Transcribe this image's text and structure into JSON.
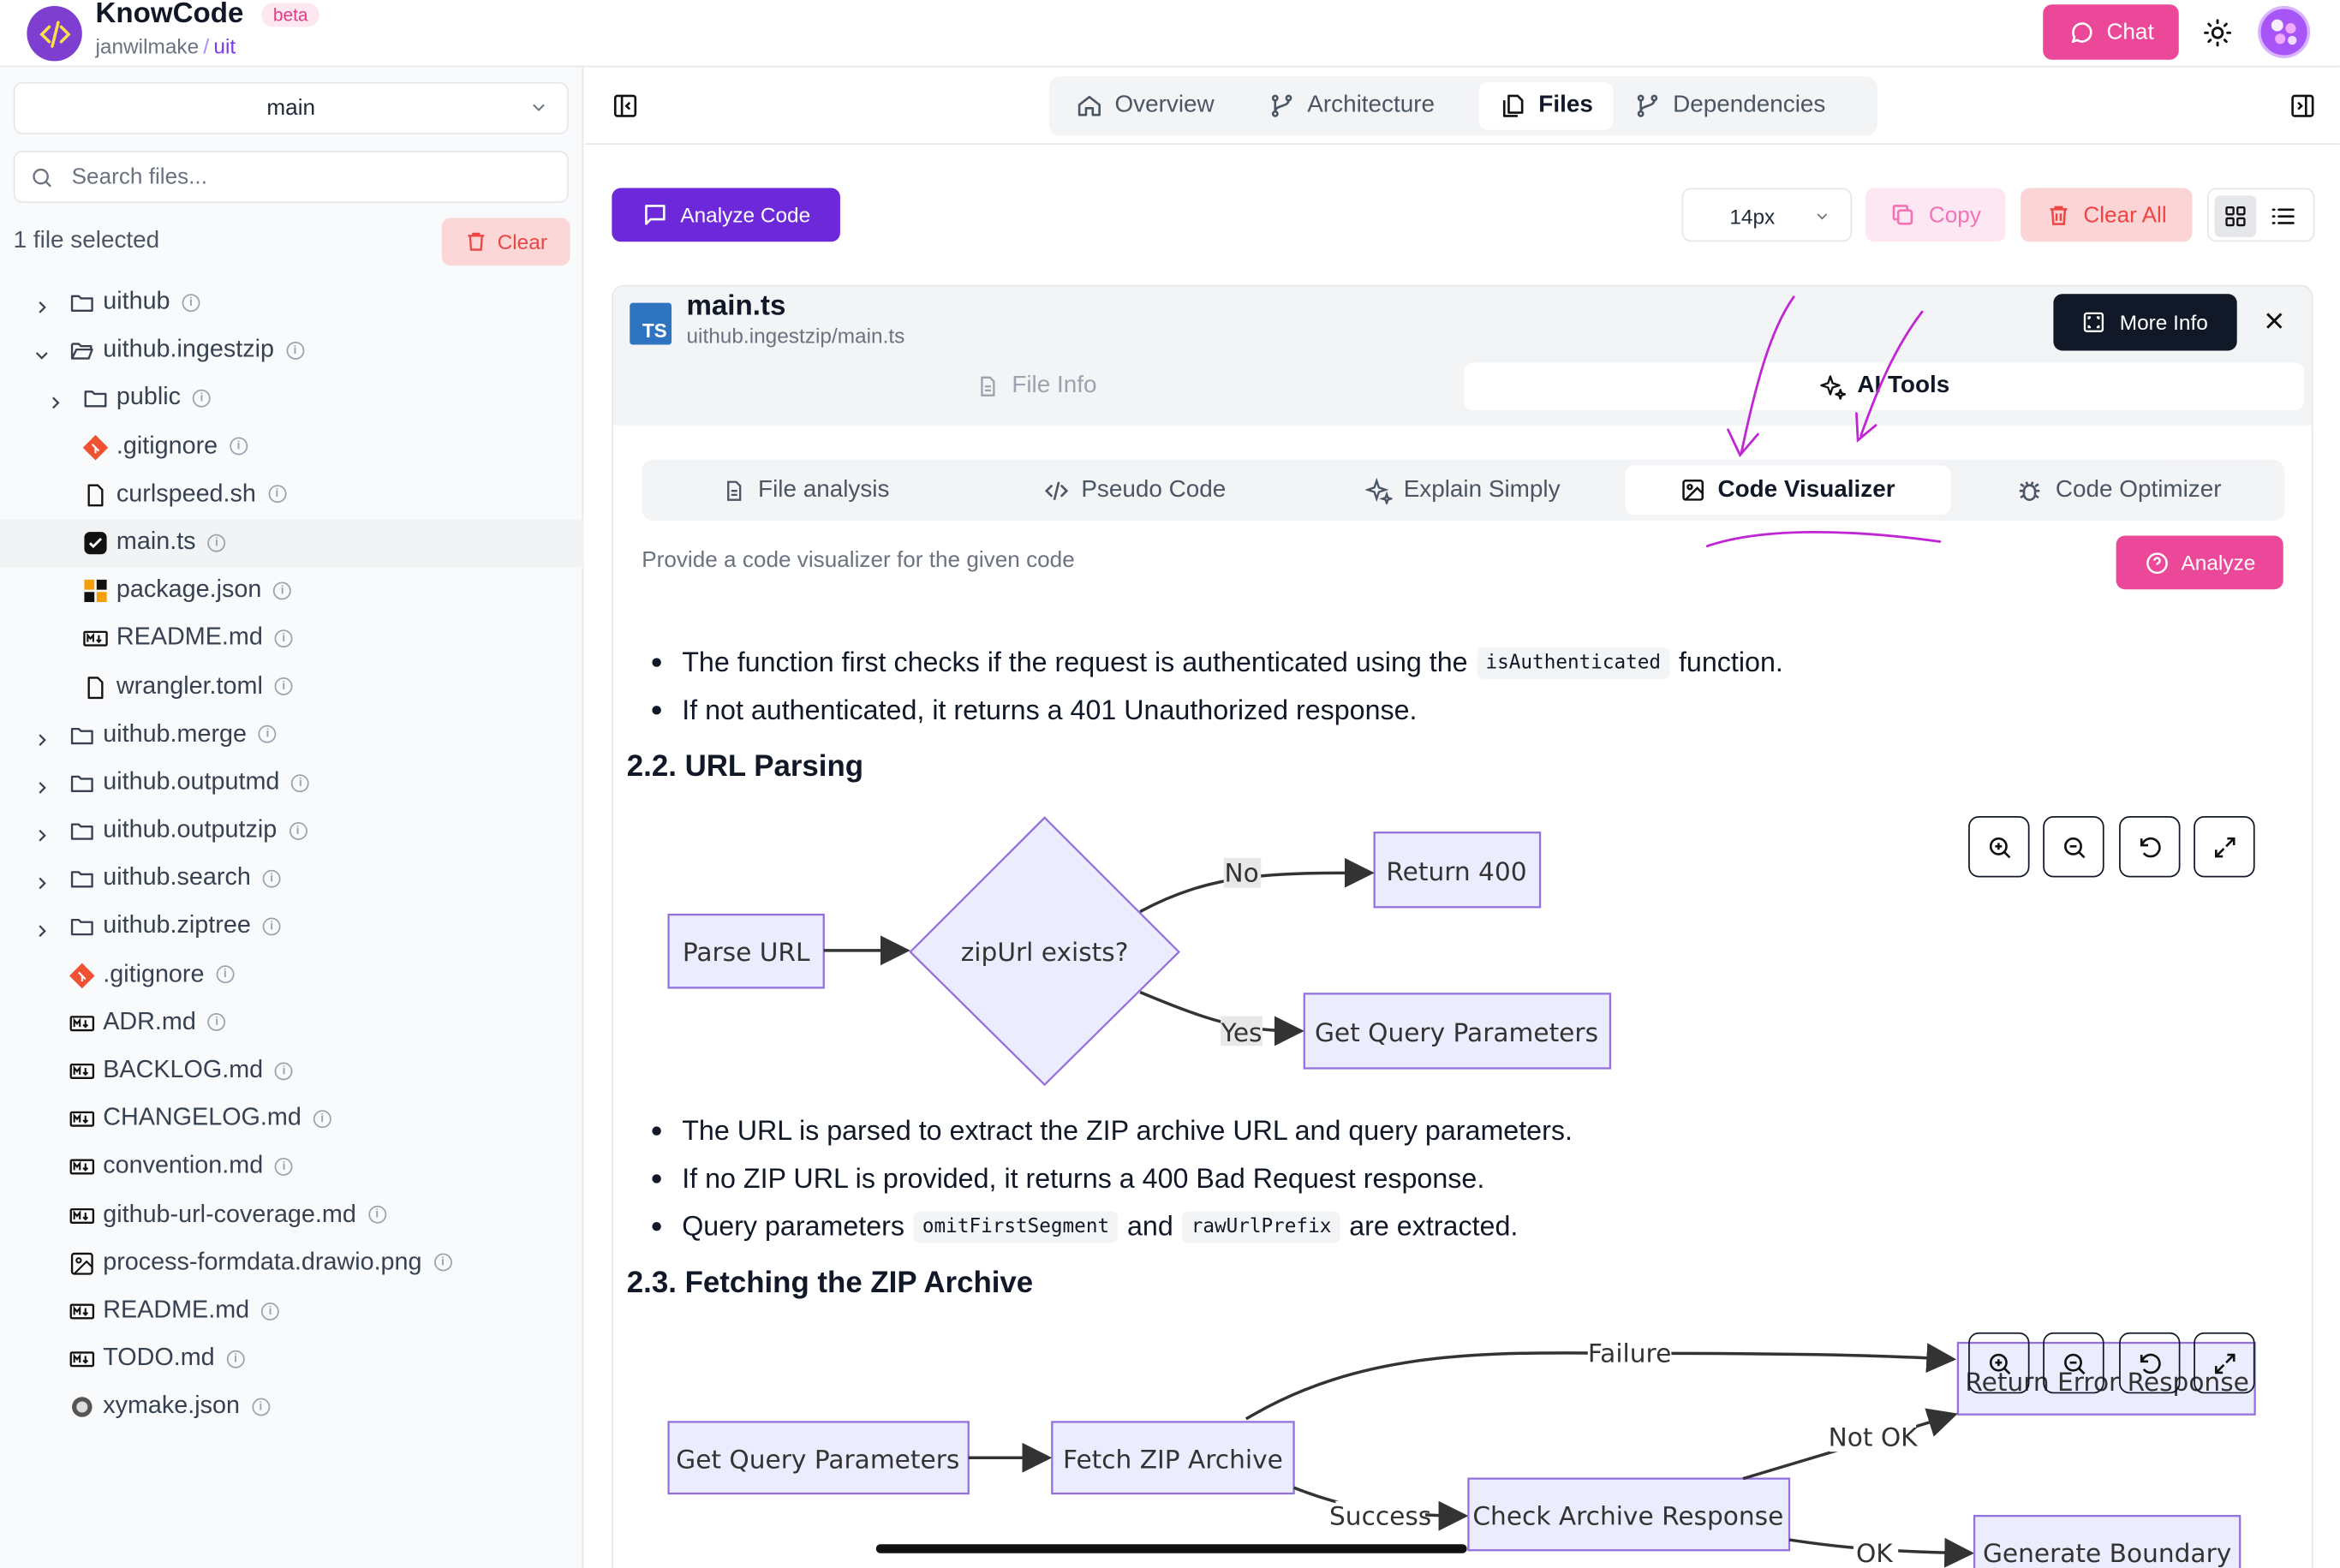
{
  "app": {
    "name": "KnowCode",
    "badge": "beta",
    "owner": "janwilmake",
    "repo": "uit",
    "chat_label": "Chat"
  },
  "sidebar": {
    "branch": "main",
    "search_placeholder": "Search files...",
    "selected_count": "1 file selected",
    "clear_label": "Clear",
    "items": [
      {
        "label": "uithub",
        "type": "folder",
        "depth": 0,
        "state": "collapsed"
      },
      {
        "label": "uithub.ingestzip",
        "type": "folder",
        "depth": 0,
        "state": "expanded"
      },
      {
        "label": "public",
        "type": "folder",
        "depth": 1,
        "state": "collapsed"
      },
      {
        "label": ".gitignore",
        "type": "git",
        "depth": 1
      },
      {
        "label": "curlspeed.sh",
        "type": "file",
        "depth": 1
      },
      {
        "label": "main.ts",
        "type": "checked",
        "depth": 1,
        "active": true
      },
      {
        "label": "package.json",
        "type": "pkg",
        "depth": 1
      },
      {
        "label": "README.md",
        "type": "md",
        "depth": 1
      },
      {
        "label": "wrangler.toml",
        "type": "file",
        "depth": 1
      },
      {
        "label": "uithub.merge",
        "type": "folder",
        "depth": 0,
        "state": "collapsed"
      },
      {
        "label": "uithub.outputmd",
        "type": "folder",
        "depth": 0,
        "state": "collapsed"
      },
      {
        "label": "uithub.outputzip",
        "type": "folder",
        "depth": 0,
        "state": "collapsed"
      },
      {
        "label": "uithub.search",
        "type": "folder",
        "depth": 0,
        "state": "collapsed"
      },
      {
        "label": "uithub.ziptree",
        "type": "folder",
        "depth": 0,
        "state": "collapsed"
      },
      {
        "label": ".gitignore",
        "type": "git",
        "depth": 0
      },
      {
        "label": "ADR.md",
        "type": "md",
        "depth": 0
      },
      {
        "label": "BACKLOG.md",
        "type": "md",
        "depth": 0
      },
      {
        "label": "CHANGELOG.md",
        "type": "md",
        "depth": 0
      },
      {
        "label": "convention.md",
        "type": "md",
        "depth": 0
      },
      {
        "label": "github-url-coverage.md",
        "type": "md",
        "depth": 0
      },
      {
        "label": "process-formdata.drawio.png",
        "type": "image",
        "depth": 0
      },
      {
        "label": "README.md",
        "type": "md",
        "depth": 0
      },
      {
        "label": "TODO.md",
        "type": "md",
        "depth": 0
      },
      {
        "label": "xymake.json",
        "type": "json",
        "depth": 0
      }
    ]
  },
  "nav": {
    "tabs": [
      "Overview",
      "Architecture",
      "Files",
      "Dependencies"
    ],
    "active": "Files"
  },
  "toolbar": {
    "analyze_code": "Analyze Code",
    "font_size": "14px",
    "copy": "Copy",
    "clear_all": "Clear All"
  },
  "file": {
    "icon_text": "TS",
    "name": "main.ts",
    "path": "uithub.ingestzip/main.ts",
    "more_info": "More Info",
    "tabs": {
      "file_info": "File Info",
      "ai_tools": "AI Tools"
    }
  },
  "ai": {
    "tabs": [
      "File analysis",
      "Pseudo Code",
      "Explain Simply",
      "Code Visualizer",
      "Code Optimizer"
    ],
    "active": "Code Visualizer",
    "prompt": "Provide a code visualizer for the given code",
    "analyze": "Analyze"
  },
  "content": {
    "bullets1": [
      {
        "before": "The function first checks if the request is authenticated using the",
        "code": "isAuthenticated",
        "after": "function."
      },
      {
        "before": "If not authenticated, it returns a 401 Unauthorized response."
      }
    ],
    "h_url": "2.2. URL Parsing",
    "diagram1": {
      "nodes": {
        "parse": "Parse URL",
        "decision": "zipUrl exists?",
        "ret400": "Return 400",
        "getq": "Get Query Parameters"
      },
      "edges": {
        "no": "No",
        "yes": "Yes"
      }
    },
    "bullets2": [
      {
        "text": "The URL is parsed to extract the ZIP archive URL and query parameters."
      },
      {
        "text": "If no ZIP URL is provided, it returns a 400 Bad Request response."
      },
      {
        "before": "Query parameters",
        "code1": "omitFirstSegment",
        "mid": "and",
        "code2": "rawUrlPrefix",
        "after": "are extracted."
      }
    ],
    "h_fetch": "2.3. Fetching the ZIP Archive",
    "diagram2": {
      "nodes": {
        "getq": "Get Query Parameters",
        "fetch": "Fetch ZIP Archive",
        "check": "Check Archive Response",
        "reterr": "Return Error Response",
        "gen": "Generate Boundary"
      },
      "edges": {
        "failure": "Failure",
        "success": "Success",
        "notok": "Not OK",
        "ok": "OK"
      }
    }
  }
}
